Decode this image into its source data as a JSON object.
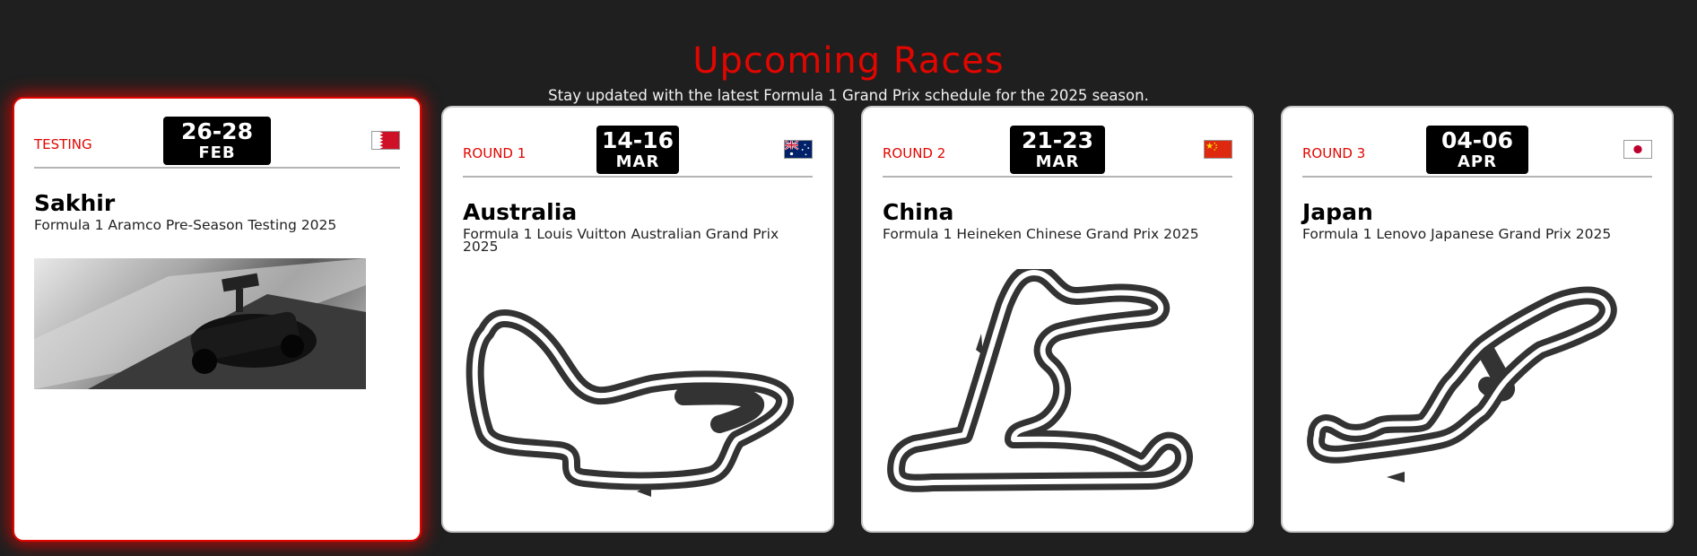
{
  "header": {
    "title": "Upcoming Races",
    "subtitle": "Stay updated with the latest Formula 1 Grand Prix schedule for the 2025 season."
  },
  "races": [
    {
      "round": "TESTING",
      "days": "26-28",
      "month": "FEB",
      "flag": "bahrain-flag",
      "location": "Sakhir",
      "name": "Formula 1 Aramco Pre-Season Testing 2025",
      "media": "pre-season-testing-photo",
      "active": true
    },
    {
      "round": "ROUND 1",
      "days": "14-16",
      "month": "MAR",
      "flag": "australia-flag",
      "location": "Australia",
      "name": "Formula 1 Louis Vuitton Australian Grand Prix 2025",
      "media": "albert-park-track-icon"
    },
    {
      "round": "ROUND 2",
      "days": "21-23",
      "month": "MAR",
      "flag": "china-flag",
      "location": "China",
      "name": "Formula 1 Heineken Chinese Grand Prix 2025",
      "media": "shanghai-track-icon"
    },
    {
      "round": "ROUND 3",
      "days": "04-06",
      "month": "APR",
      "flag": "japan-flag",
      "location": "Japan",
      "name": "Formula 1 Lenovo Japanese Grand Prix 2025",
      "media": "suzuka-track-icon"
    }
  ],
  "colors": {
    "accent": "#e10600",
    "background": "#1f1f1f",
    "card": "#ffffff",
    "badge": "#000000",
    "track": "#333333"
  }
}
